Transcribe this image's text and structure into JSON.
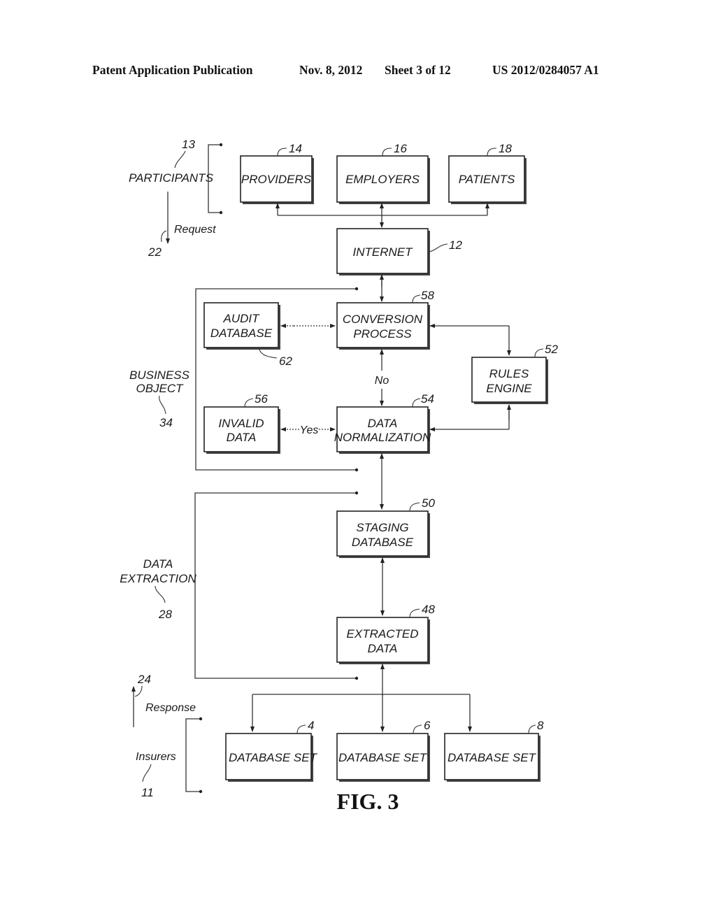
{
  "header": {
    "publication": "Patent Application Publication",
    "date": "Nov. 8, 2012",
    "sheet": "Sheet 3 of 12",
    "number": "US 2012/0284057 A1"
  },
  "figure": {
    "caption": "FIG. 3",
    "groups": {
      "participants": {
        "label": "PARTICIPANTS",
        "ref": "13"
      },
      "request": {
        "label": "Request",
        "ref": "22"
      },
      "business_object": {
        "line1": "BUSINESS",
        "line2": "OBJECT",
        "ref": "34"
      },
      "data_extraction": {
        "line1": "DATA",
        "line2": "EXTRACTION",
        "ref": "28"
      },
      "response": {
        "label": "Response",
        "ref": "24"
      },
      "insurers": {
        "label": "Insurers",
        "ref": "11"
      }
    },
    "boxes": {
      "providers": {
        "line1": "PROVIDERS",
        "ref": "14"
      },
      "employers": {
        "line1": "EMPLOYERS",
        "ref": "16"
      },
      "patients": {
        "line1": "PATIENTS",
        "ref": "18"
      },
      "internet": {
        "line1": "INTERNET",
        "ref": "12"
      },
      "audit_database": {
        "line1": "AUDIT",
        "line2": "DATABASE",
        "ref": "62"
      },
      "conversion_process": {
        "line1": "CONVERSION",
        "line2": "PROCESS",
        "ref": "58"
      },
      "rules_engine": {
        "line1": "RULES",
        "line2": "ENGINE",
        "ref": "52"
      },
      "invalid_data": {
        "line1": "INVALID",
        "line2": "DATA",
        "ref": "56"
      },
      "data_normalization": {
        "line1": "DATA",
        "line2": "NORMALIZATION",
        "ref": "54"
      },
      "staging_database": {
        "line1": "STAGING",
        "line2": "DATABASE",
        "ref": "50"
      },
      "extracted_data": {
        "line1": "EXTRACTED",
        "line2": "DATA",
        "ref": "48"
      },
      "database_set_4": {
        "line1": "DATABASE SET",
        "ref": "4"
      },
      "database_set_6": {
        "line1": "DATABASE SET",
        "ref": "6"
      },
      "database_set_8": {
        "line1": "DATABASE SET",
        "ref": "8"
      }
    },
    "edge_labels": {
      "no": "No",
      "yes": "Yes"
    }
  }
}
